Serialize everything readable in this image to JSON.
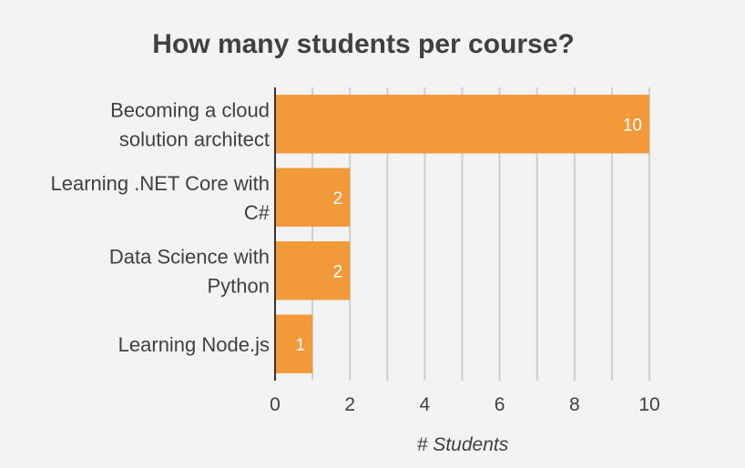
{
  "chart_data": {
    "type": "bar",
    "orientation": "horizontal",
    "title": "How many students per course?",
    "xlabel": "# Students",
    "ylabel": "",
    "categories": [
      [
        "Becoming a cloud",
        "solution architect"
      ],
      [
        "Learning .NET Core with",
        "C#"
      ],
      [
        "Data Science with",
        "Python"
      ],
      [
        "Learning Node.js"
      ]
    ],
    "values": [
      10,
      2,
      2,
      1
    ],
    "xlim": [
      0,
      10
    ],
    "x_ticks": [
      0,
      2,
      4,
      6,
      8,
      10
    ],
    "grid": true,
    "data_labels": true,
    "colors": {
      "bar": "#f2993a",
      "background": "#f3f3f3"
    }
  }
}
